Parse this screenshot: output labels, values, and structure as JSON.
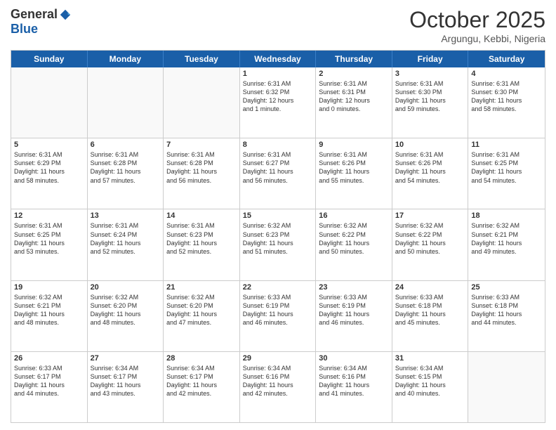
{
  "header": {
    "logo_general": "General",
    "logo_blue": "Blue",
    "month_title": "October 2025",
    "location": "Argungu, Kebbi, Nigeria"
  },
  "weekdays": [
    "Sunday",
    "Monday",
    "Tuesday",
    "Wednesday",
    "Thursday",
    "Friday",
    "Saturday"
  ],
  "weeks": [
    [
      {
        "day": "",
        "info": ""
      },
      {
        "day": "",
        "info": ""
      },
      {
        "day": "",
        "info": ""
      },
      {
        "day": "1",
        "info": "Sunrise: 6:31 AM\nSunset: 6:32 PM\nDaylight: 12 hours\nand 1 minute."
      },
      {
        "day": "2",
        "info": "Sunrise: 6:31 AM\nSunset: 6:31 PM\nDaylight: 12 hours\nand 0 minutes."
      },
      {
        "day": "3",
        "info": "Sunrise: 6:31 AM\nSunset: 6:30 PM\nDaylight: 11 hours\nand 59 minutes."
      },
      {
        "day": "4",
        "info": "Sunrise: 6:31 AM\nSunset: 6:30 PM\nDaylight: 11 hours\nand 58 minutes."
      }
    ],
    [
      {
        "day": "5",
        "info": "Sunrise: 6:31 AM\nSunset: 6:29 PM\nDaylight: 11 hours\nand 58 minutes."
      },
      {
        "day": "6",
        "info": "Sunrise: 6:31 AM\nSunset: 6:28 PM\nDaylight: 11 hours\nand 57 minutes."
      },
      {
        "day": "7",
        "info": "Sunrise: 6:31 AM\nSunset: 6:28 PM\nDaylight: 11 hours\nand 56 minutes."
      },
      {
        "day": "8",
        "info": "Sunrise: 6:31 AM\nSunset: 6:27 PM\nDaylight: 11 hours\nand 56 minutes."
      },
      {
        "day": "9",
        "info": "Sunrise: 6:31 AM\nSunset: 6:26 PM\nDaylight: 11 hours\nand 55 minutes."
      },
      {
        "day": "10",
        "info": "Sunrise: 6:31 AM\nSunset: 6:26 PM\nDaylight: 11 hours\nand 54 minutes."
      },
      {
        "day": "11",
        "info": "Sunrise: 6:31 AM\nSunset: 6:25 PM\nDaylight: 11 hours\nand 54 minutes."
      }
    ],
    [
      {
        "day": "12",
        "info": "Sunrise: 6:31 AM\nSunset: 6:25 PM\nDaylight: 11 hours\nand 53 minutes."
      },
      {
        "day": "13",
        "info": "Sunrise: 6:31 AM\nSunset: 6:24 PM\nDaylight: 11 hours\nand 52 minutes."
      },
      {
        "day": "14",
        "info": "Sunrise: 6:31 AM\nSunset: 6:23 PM\nDaylight: 11 hours\nand 52 minutes."
      },
      {
        "day": "15",
        "info": "Sunrise: 6:32 AM\nSunset: 6:23 PM\nDaylight: 11 hours\nand 51 minutes."
      },
      {
        "day": "16",
        "info": "Sunrise: 6:32 AM\nSunset: 6:22 PM\nDaylight: 11 hours\nand 50 minutes."
      },
      {
        "day": "17",
        "info": "Sunrise: 6:32 AM\nSunset: 6:22 PM\nDaylight: 11 hours\nand 50 minutes."
      },
      {
        "day": "18",
        "info": "Sunrise: 6:32 AM\nSunset: 6:21 PM\nDaylight: 11 hours\nand 49 minutes."
      }
    ],
    [
      {
        "day": "19",
        "info": "Sunrise: 6:32 AM\nSunset: 6:21 PM\nDaylight: 11 hours\nand 48 minutes."
      },
      {
        "day": "20",
        "info": "Sunrise: 6:32 AM\nSunset: 6:20 PM\nDaylight: 11 hours\nand 48 minutes."
      },
      {
        "day": "21",
        "info": "Sunrise: 6:32 AM\nSunset: 6:20 PM\nDaylight: 11 hours\nand 47 minutes."
      },
      {
        "day": "22",
        "info": "Sunrise: 6:33 AM\nSunset: 6:19 PM\nDaylight: 11 hours\nand 46 minutes."
      },
      {
        "day": "23",
        "info": "Sunrise: 6:33 AM\nSunset: 6:19 PM\nDaylight: 11 hours\nand 46 minutes."
      },
      {
        "day": "24",
        "info": "Sunrise: 6:33 AM\nSunset: 6:18 PM\nDaylight: 11 hours\nand 45 minutes."
      },
      {
        "day": "25",
        "info": "Sunrise: 6:33 AM\nSunset: 6:18 PM\nDaylight: 11 hours\nand 44 minutes."
      }
    ],
    [
      {
        "day": "26",
        "info": "Sunrise: 6:33 AM\nSunset: 6:17 PM\nDaylight: 11 hours\nand 44 minutes."
      },
      {
        "day": "27",
        "info": "Sunrise: 6:34 AM\nSunset: 6:17 PM\nDaylight: 11 hours\nand 43 minutes."
      },
      {
        "day": "28",
        "info": "Sunrise: 6:34 AM\nSunset: 6:17 PM\nDaylight: 11 hours\nand 42 minutes."
      },
      {
        "day": "29",
        "info": "Sunrise: 6:34 AM\nSunset: 6:16 PM\nDaylight: 11 hours\nand 42 minutes."
      },
      {
        "day": "30",
        "info": "Sunrise: 6:34 AM\nSunset: 6:16 PM\nDaylight: 11 hours\nand 41 minutes."
      },
      {
        "day": "31",
        "info": "Sunrise: 6:34 AM\nSunset: 6:15 PM\nDaylight: 11 hours\nand 40 minutes."
      },
      {
        "day": "",
        "info": ""
      }
    ]
  ]
}
